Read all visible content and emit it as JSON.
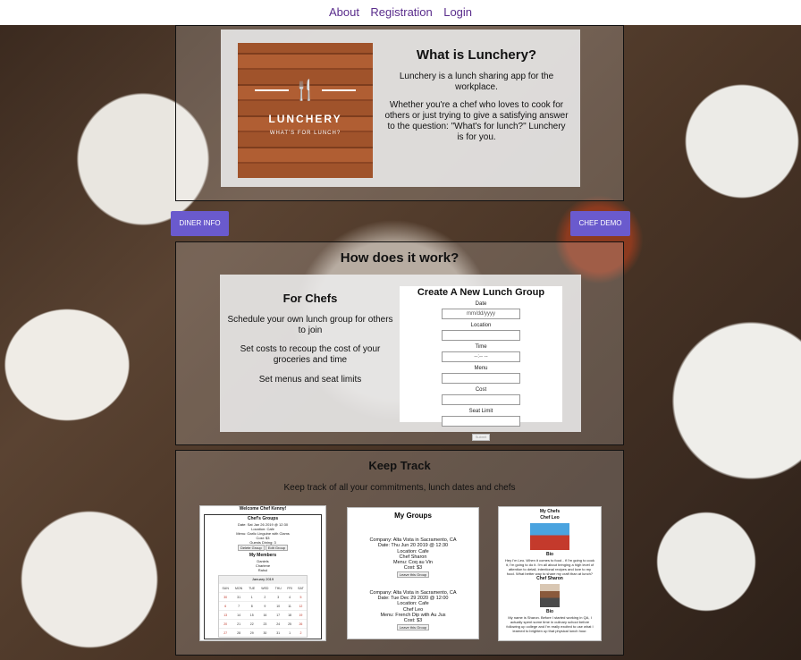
{
  "nav": {
    "about": "About",
    "registration": "Registration",
    "login": "Login"
  },
  "intro": {
    "logo_title": "LUNCHERY",
    "logo_tagline": "WHAT'S FOR LUNCH?",
    "heading": "What is Lunchery?",
    "para1": "Lunchery is a lunch sharing app for the workplace.",
    "para2": "Whether you're a chef who loves to cook for others or just trying to give a satisfying answer to the question: \"What's for lunch?\" Lunchery is for you."
  },
  "buttons": {
    "diner_info": "DINER INFO",
    "chef_demo": "CHEF DEMO"
  },
  "how": {
    "heading": "How does it work?",
    "for_chefs": {
      "heading": "For Chefs",
      "p1": "Schedule your own lunch group for others to join",
      "p2": "Set costs to recoup the cost of your groceries and time",
      "p3": "Set menus and seat limits"
    },
    "form": {
      "title": "Create A New Lunch Group",
      "date_label": "Date",
      "date_placeholder": "mm/dd/yyyy",
      "location_label": "Location",
      "time_label": "Time",
      "time_placeholder": "--:-- --",
      "menu_label": "Menu",
      "cost_label": "Cost",
      "seat_label": "Seat Limit",
      "submit": "Submit"
    }
  },
  "keep": {
    "heading": "Keep Track",
    "subtitle": "Keep track of all your commitments, lunch dates and chefs",
    "shot1": {
      "welcome": "Welcome Chef Kenny!",
      "groups_title": "Chef's Groups",
      "group_lines": [
        "Date: Sat Jan 26 2019 @ 12:30",
        "Location: Cafe",
        "Menu: Garlic Linguine with Clams",
        "Cost: $3",
        "Guests Dining: 3"
      ],
      "btn_a": "Delete Group",
      "btn_b": "Edit Group",
      "members_title": "My Members",
      "members": [
        "Daniels",
        "Charlene",
        "Rahul"
      ],
      "cal_month": "January 2019",
      "cal_days": [
        "SUN",
        "MON",
        "TUE",
        "WED",
        "THU",
        "FRI",
        "SAT"
      ],
      "cal_rows": [
        [
          "30",
          "31",
          "1",
          "2",
          "3",
          "4",
          "5"
        ],
        [
          "6",
          "7",
          "8",
          "9",
          "10",
          "11",
          "12"
        ],
        [
          "13",
          "14",
          "15",
          "16",
          "17",
          "18",
          "19"
        ],
        [
          "20",
          "21",
          "22",
          "23",
          "24",
          "25",
          "26"
        ],
        [
          "27",
          "28",
          "29",
          "30",
          "31",
          "1",
          "2"
        ]
      ]
    },
    "shot2": {
      "title": "My Groups",
      "groups": [
        {
          "company": "Company: Alta Vista in Sacramento, CA",
          "date": "Date: Thu Jun 20 2019 @ 12:30",
          "location": "Location: Cafe",
          "chef": "Chef Sharon",
          "menu": "Menu: Coq au Vin",
          "cost": "Cost: $3",
          "leave": "Leave this Group"
        },
        {
          "company": "Company: Alta Vista in Sacramento, CA",
          "date": "Date: Tue Dec 29 2020 @ 12:00",
          "location": "Location: Cafe",
          "chef": "Chef Leo",
          "menu": "Menu: French Dip with Au Jus",
          "cost": "Cost: $3",
          "leave": "Leave this Group"
        }
      ]
    },
    "shot3": {
      "title": "My Chefs",
      "chef1": "Chef Leo",
      "bio_label1": "Bio",
      "bio1": "Hey I'm Leo. When it comes to food - if I'm going to cook it, I'm going to do it. I'm all about bringing a high level of attention to detail, intentional recipes and love to my food. What better way to share my craft than at lunch?",
      "chef2": "Chef Sharon",
      "bio_label2": "Bio",
      "bio2": "My name is Sharon. Before I started working in QA, I actually spent some time in culinary school before following up college and I'm really excited to use what I learned to brighten up that physical lunch hour."
    }
  },
  "colors": {
    "nav_link": "#5a2d8c",
    "button": "#6a5acd"
  }
}
